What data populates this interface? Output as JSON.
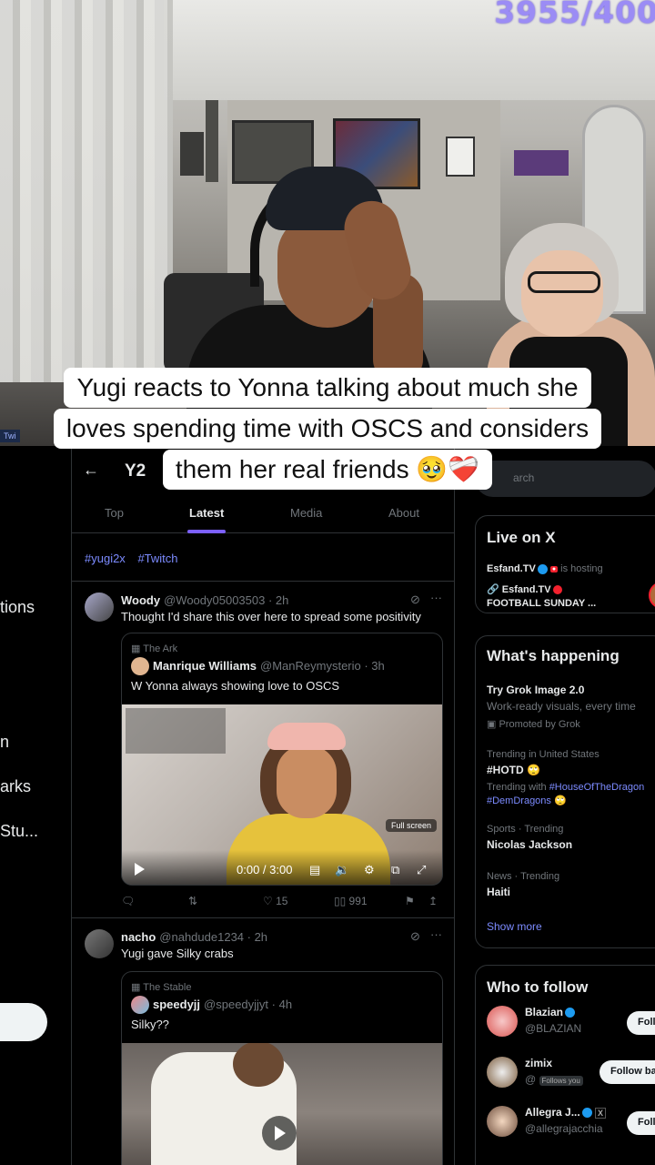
{
  "stream": {
    "counter": "3955/400",
    "twitch_tag": "Twi"
  },
  "caption": {
    "line1": "Yugi reacts to Yonna talking about much she",
    "line2": "loves spending time with OSCS and considers",
    "line3": "them her real friends 🥹❤️‍🩹"
  },
  "left_nav": {
    "items": [
      "tions",
      "n",
      "arks",
      "Stu..."
    ]
  },
  "feed": {
    "title": "Y2",
    "back_icon": "arrow-left-icon",
    "tabs": [
      "Top",
      "Latest",
      "Media",
      "About"
    ],
    "active_tab": "Latest",
    "hashtags": [
      "#yugi2x",
      "#Twitch"
    ],
    "accent": "#7c60ff",
    "tweets": [
      {
        "name": "Woody",
        "handle": "@Woody05003503 · 2h",
        "text": "Thought I'd share this over here to spread some positivity",
        "quote": {
          "context": "The Ark",
          "name": "Manrique Williams",
          "handle": "@ManReymysterio · 3h",
          "text": "W Yonna always showing love to OSCS",
          "video": {
            "time": "0:00 / 3:00",
            "fullscreen_label": "Full screen"
          }
        },
        "actions": {
          "likes": "15",
          "views": "991"
        }
      },
      {
        "name": "nacho",
        "handle": "@nahdude1234 · 2h",
        "text": "Yugi gave Silky crabs",
        "quote": {
          "context": "The Stable",
          "name": "speedyjj",
          "handle": "@speedyjjyt · 4h",
          "text": "Silky??"
        }
      }
    ]
  },
  "right": {
    "search_placeholder": "arch",
    "live": {
      "title": "Live on X",
      "row1_name": "Esfand.TV",
      "row1_status": "is hosting",
      "row2_name": "Esfand.TV",
      "row2_title": "FOOTBALL SUNDAY ..."
    },
    "happening": {
      "title": "What's happening",
      "promo_title": "Try Grok Image 2.0",
      "promo_sub": "Work-ready visuals, every time",
      "promo_by": "Promoted by Grok",
      "t1_context": "Trending in United States",
      "t1_title": "#HOTD",
      "t1_with": "Trending with",
      "t1_link1": "#HouseOfTheDragon",
      "t1_link2": "#DemDragons",
      "t2_context": "Sports · Trending",
      "t2_title": "Nicolas Jackson",
      "t3_context": "News · Trending",
      "t3_title": "Haiti",
      "show_more": "Show more"
    },
    "who_to_follow": {
      "title": "Who to follow",
      "users": [
        {
          "name": "Blazian",
          "handle": "@BLAZIAN",
          "button": "Follow"
        },
        {
          "name": "zimix",
          "handle": "@",
          "follows_you": "Follows you",
          "button": "Follow back"
        },
        {
          "name": "Allegra J...",
          "handle": "@allegrajacchia",
          "button": "Follow"
        }
      ]
    }
  }
}
